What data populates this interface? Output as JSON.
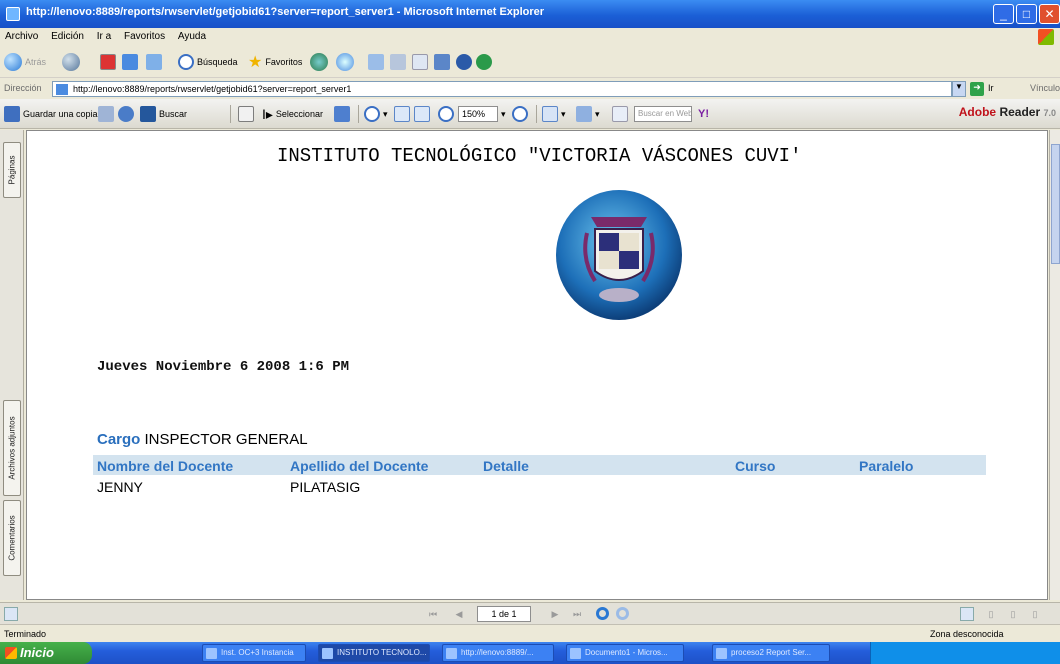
{
  "window": {
    "title": "http://lenovo:8889/reports/rwservlet/getjobid61?server=report_server1 - Microsoft Internet Explorer"
  },
  "menu": [
    "Archivo",
    "Edición",
    "Ir a",
    "Favoritos",
    "Ayuda"
  ],
  "nav_toolbar": {
    "back": "Atrás",
    "search": "Búsqueda",
    "favorites": "Favoritos"
  },
  "address": {
    "label": "Dirección",
    "url": "http://lenovo:8889/reports/rwservlet/getjobid61?server=report_server1",
    "go": "Ir",
    "links": "Vínculos"
  },
  "adobe_toolbar": {
    "save_copy": "Guardar una copia",
    "find": "Buscar",
    "select": "Seleccionar",
    "zoom": "150%",
    "search_web": "Buscar en Web",
    "reader_brand": "Adobe",
    "reader_name": "Reader",
    "reader_version": "7.0"
  },
  "side_tabs": [
    "Páginas",
    "Archivos adjuntos",
    "Comentarios"
  ],
  "report": {
    "institution": "INSTITUTO TECNOLÓGICO \"VICTORIA VÁSCONES CUVI'",
    "date": "Jueves Noviembre 6 2008 1:6 PM",
    "cargo_label": "Cargo",
    "cargo_value": "INSPECTOR GENERAL",
    "columns": [
      "Nombre del Docente",
      "Apellido del Docente",
      "Detalle",
      "Curso",
      "Paralelo"
    ],
    "rows": [
      [
        "JENNY",
        "PILATASIG",
        "",
        "",
        ""
      ]
    ]
  },
  "page_nav": {
    "page_indicator": "1 de 1"
  },
  "status": {
    "left": "Terminado",
    "right": "Zona desconocida"
  },
  "taskbar": {
    "start": "Inicio",
    "tasks": [
      "Inst. OC+3 Instancia",
      "INSTITUTO TECNOLO...",
      "http://lenovo:8889/...",
      "Documento1 - Micros...",
      "proceso2 Report Ser..."
    ]
  }
}
